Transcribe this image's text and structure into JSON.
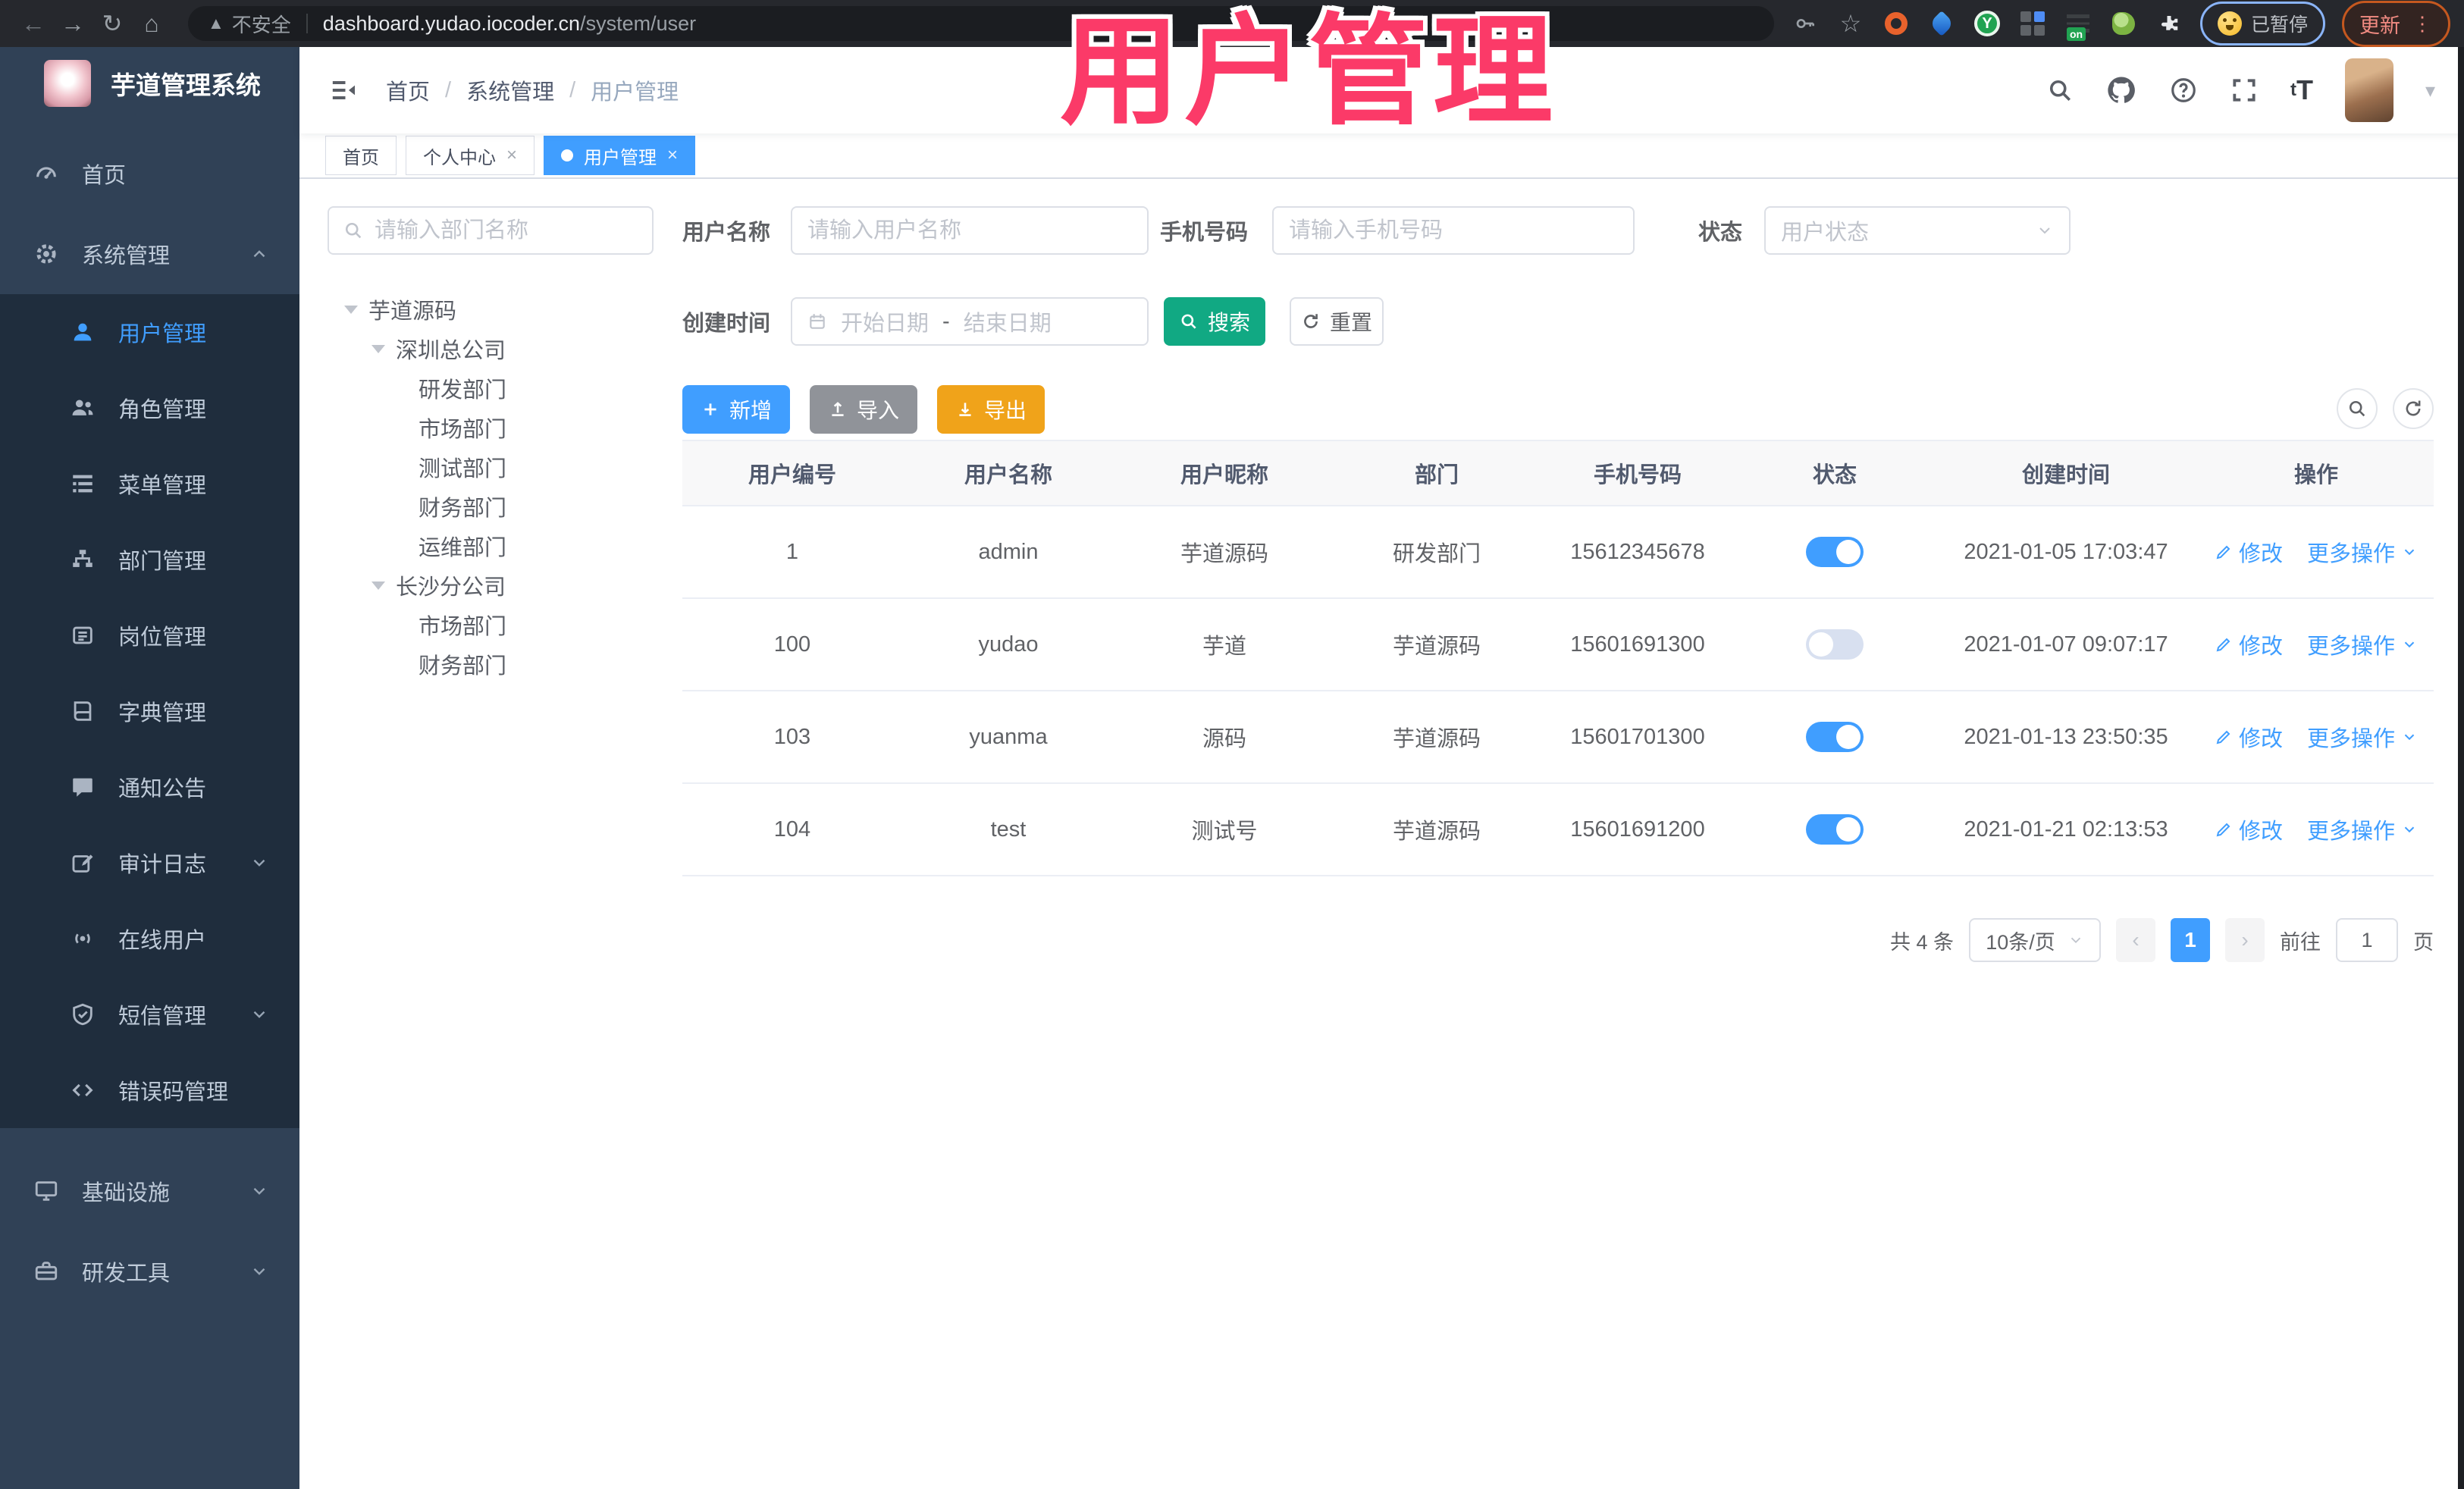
{
  "colors": {
    "primary": "#409eff",
    "search_button": "#11a983",
    "export_button": "#f0a31a",
    "import_button": "#909399",
    "overlay_pink": "#fb3a68",
    "sidebar_bg": "#304156",
    "submenu_bg": "#1f2d3d"
  },
  "browser": {
    "security_label": "不安全",
    "url_host": "dashboard.yudao.iocoder.cn",
    "url_path": "/system/user",
    "paused_label": "已暂停",
    "update_label": "更新"
  },
  "overlay": {
    "title": "用户管理"
  },
  "sidebar": {
    "logo_title": "芋道管理系统",
    "items": [
      {
        "label": "首页",
        "icon": "dashboard-icon"
      },
      {
        "label": "系统管理",
        "icon": "gear-icon",
        "arrow": "up"
      },
      {
        "label": "用户管理",
        "icon": "user-icon",
        "active": true
      },
      {
        "label": "角色管理",
        "icon": "peoples-icon"
      },
      {
        "label": "菜单管理",
        "icon": "tree-table-icon"
      },
      {
        "label": "部门管理",
        "icon": "tree-icon"
      },
      {
        "label": "岗位管理",
        "icon": "post-icon"
      },
      {
        "label": "字典管理",
        "icon": "dict-icon"
      },
      {
        "label": "通知公告",
        "icon": "message-icon"
      },
      {
        "label": "审计日志",
        "icon": "edit-icon",
        "arrow": "down"
      },
      {
        "label": "在线用户",
        "icon": "online-users-icon"
      },
      {
        "label": "短信管理",
        "icon": "shield-check-icon",
        "arrow": "down"
      },
      {
        "label": "错误码管理",
        "icon": "code-icon"
      },
      {
        "label": "基础设施",
        "icon": "monitor-icon",
        "arrow": "down"
      },
      {
        "label": "研发工具",
        "icon": "toolbox-icon",
        "arrow": "down"
      }
    ]
  },
  "header": {
    "breadcrumb": [
      "首页",
      "系统管理",
      "用户管理"
    ],
    "separator": "/"
  },
  "tabs": [
    {
      "label": "首页"
    },
    {
      "label": "个人中心",
      "close": "×"
    },
    {
      "label": "用户管理",
      "close": "×",
      "active": true
    }
  ],
  "dept": {
    "search_placeholder": "请输入部门名称",
    "nodes": [
      {
        "label": "芋道源码"
      },
      {
        "label": "深圳总公司"
      },
      {
        "label": "研发部门"
      },
      {
        "label": "市场部门"
      },
      {
        "label": "测试部门"
      },
      {
        "label": "财务部门"
      },
      {
        "label": "运维部门"
      },
      {
        "label": "长沙分公司"
      },
      {
        "label": "市场部门"
      },
      {
        "label": "财务部门"
      }
    ]
  },
  "filter": {
    "username_label": "用户名称",
    "username_placeholder": "请输入用户名称",
    "mobile_label": "手机号码",
    "mobile_placeholder": "请输入手机号码",
    "status_label": "状态",
    "status_placeholder": "用户状态",
    "date_label": "创建时间",
    "date_start": "开始日期",
    "date_sep": "-",
    "date_end": "结束日期",
    "search_label": "搜索",
    "reset_label": "重置"
  },
  "toolbar": {
    "add_label": "新增",
    "import_label": "导入",
    "export_label": "导出"
  },
  "table": {
    "headers": [
      "用户编号",
      "用户名称",
      "用户昵称",
      "部门",
      "手机号码",
      "状态",
      "创建时间",
      "操作"
    ],
    "modify_label": "修改",
    "more_label": "更多操作",
    "rows": [
      {
        "id": "1",
        "username": "admin",
        "nickname": "芋道源码",
        "dept": "研发部门",
        "mobile": "15612345678",
        "status": "on",
        "created": "2021-01-05 17:03:47"
      },
      {
        "id": "100",
        "username": "yudao",
        "nickname": "芋道",
        "dept": "芋道源码",
        "mobile": "15601691300",
        "status": "off",
        "created": "2021-01-07 09:07:17"
      },
      {
        "id": "103",
        "username": "yuanma",
        "nickname": "源码",
        "dept": "芋道源码",
        "mobile": "15601701300",
        "status": "on",
        "created": "2021-01-13 23:50:35"
      },
      {
        "id": "104",
        "username": "test",
        "nickname": "测试号",
        "dept": "芋道源码",
        "mobile": "15601691200",
        "status": "on",
        "created": "2021-01-21 02:13:53"
      }
    ]
  },
  "pagination": {
    "total": "共 4 条",
    "page_size": "10条/页",
    "page": "1",
    "goto_label": "前往",
    "goto_value": "1",
    "unit": "页"
  }
}
